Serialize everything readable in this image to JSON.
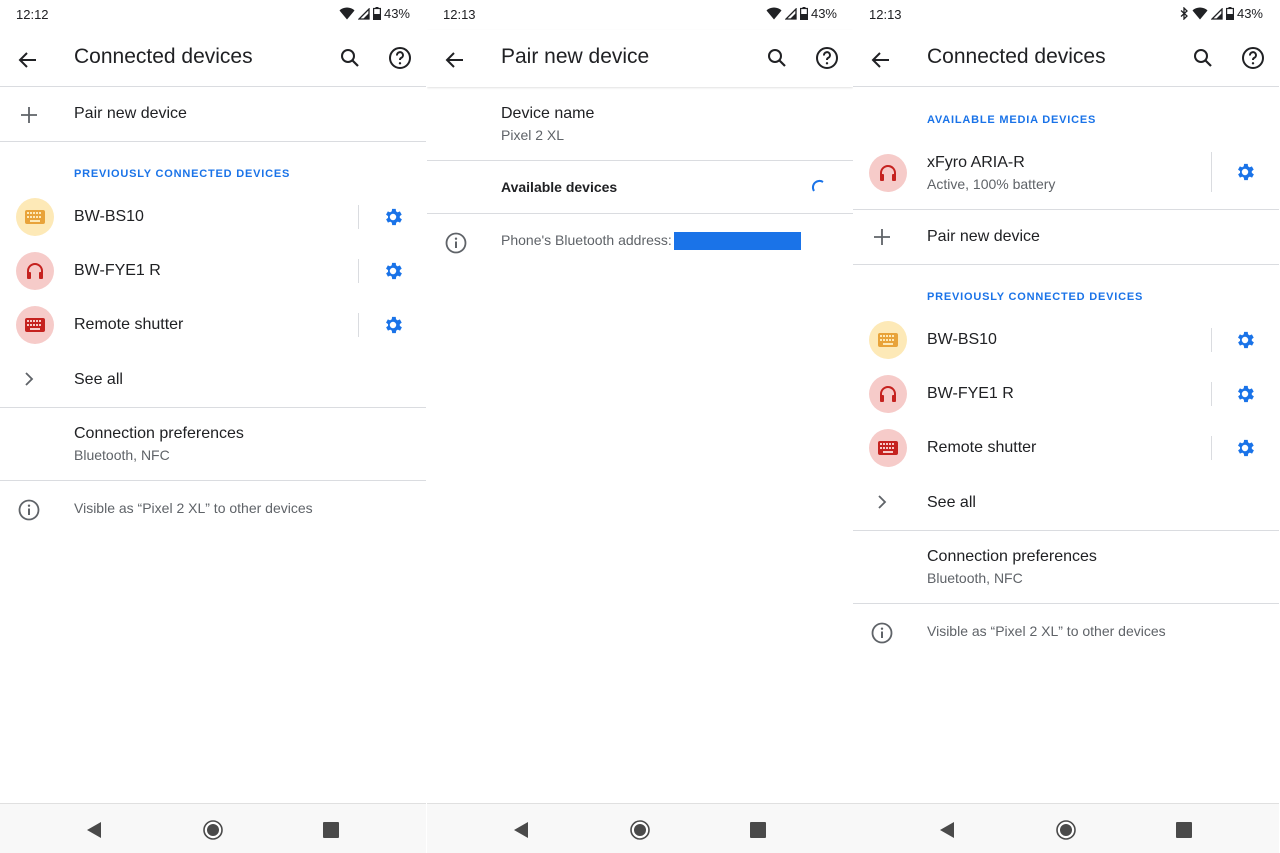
{
  "colors": {
    "accent": "#1a73e8",
    "keyboard_yellow_bg": "#fde9b7",
    "keyboard_yellow_fg": "#e8a33a",
    "red_bg": "#f6cbc9",
    "red_fg": "#c5221f"
  },
  "screen1": {
    "status": {
      "time": "12:12",
      "battery": "43%"
    },
    "appbar": {
      "title": "Connected devices"
    },
    "pair_new": "Pair new device",
    "prev_header": "PREVIOUSLY CONNECTED DEVICES",
    "devices": [
      {
        "name": "BW-BS10",
        "icon": "keyboard-icon",
        "color": "yellow"
      },
      {
        "name": "BW-FYE1 R",
        "icon": "headset-icon",
        "color": "red"
      },
      {
        "name": "Remote shutter",
        "icon": "keyboard-icon",
        "color": "red"
      }
    ],
    "see_all": "See all",
    "prefs": {
      "title": "Connection preferences",
      "sub": "Bluetooth, NFC"
    },
    "visible": "Visible as “Pixel 2 XL” to other devices"
  },
  "screen2": {
    "status": {
      "time": "12:13",
      "battery": "43%"
    },
    "appbar": {
      "title": "Pair new device"
    },
    "device_name": {
      "title": "Device name",
      "sub": "Pixel 2 XL"
    },
    "available": "Available devices",
    "address_label": "Phone's Bluetooth address:"
  },
  "screen3": {
    "status": {
      "time": "12:13",
      "battery": "43%"
    },
    "appbar": {
      "title": "Connected devices"
    },
    "media_header": "AVAILABLE MEDIA DEVICES",
    "media_device": {
      "name": "xFyro ARIA-R",
      "sub": "Active, 100% battery",
      "icon": "headset-icon"
    },
    "pair_new": "Pair new device",
    "prev_header": "PREVIOUSLY CONNECTED DEVICES",
    "devices": [
      {
        "name": "BW-BS10",
        "icon": "keyboard-icon",
        "color": "yellow"
      },
      {
        "name": "BW-FYE1 R",
        "icon": "headset-icon",
        "color": "red"
      },
      {
        "name": "Remote shutter",
        "icon": "keyboard-icon",
        "color": "red"
      }
    ],
    "see_all": "See all",
    "prefs": {
      "title": "Connection preferences",
      "sub": "Bluetooth, NFC"
    },
    "visible": "Visible as “Pixel 2 XL” to other devices"
  }
}
